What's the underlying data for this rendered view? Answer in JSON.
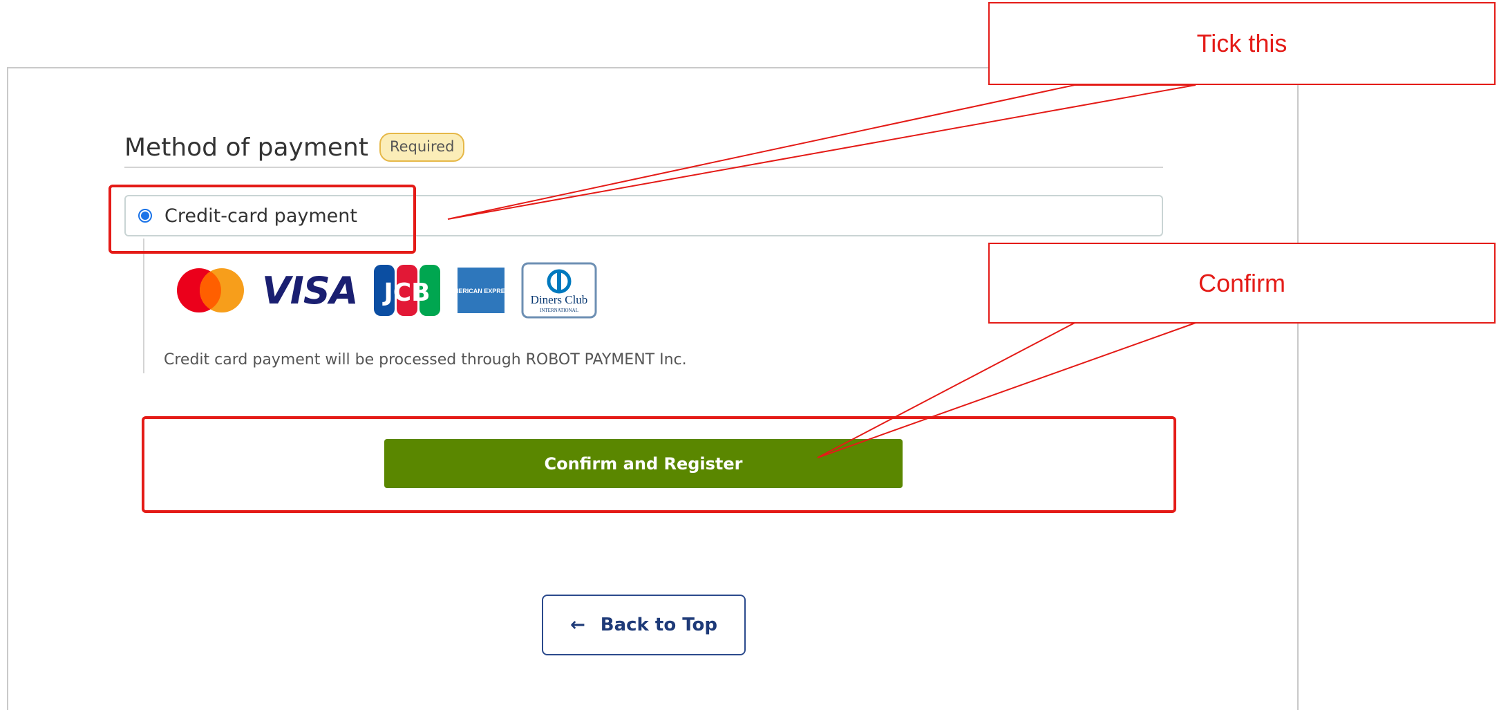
{
  "payment": {
    "section_title": "Method of payment",
    "required_badge": "Required",
    "option_label": "Credit-card payment",
    "option_selected": true,
    "card_brands": [
      "mastercard-icon",
      "visa-icon",
      "jcb-icon",
      "american-express-icon",
      "diners-club-icon"
    ],
    "visa_text": "VISA",
    "jcb_text": "JCB",
    "amex_text": "AMERICAN EXPRESS",
    "diners_text": "Diners Club",
    "diners_sub": "INTERNATIONAL",
    "note": "Credit card payment will be processed through ROBOT PAYMENT Inc."
  },
  "actions": {
    "confirm_label": "Confirm and Register",
    "back_label": "Back to Top",
    "back_arrow": "←"
  },
  "annotations": {
    "tick_label": "Tick this",
    "confirm_label": "Confirm"
  },
  "colors": {
    "confirm_button": "#5a8700",
    "annotation_red": "#e41b17",
    "radio_blue": "#1a73e8",
    "badge_bg": "#fbedb8"
  }
}
